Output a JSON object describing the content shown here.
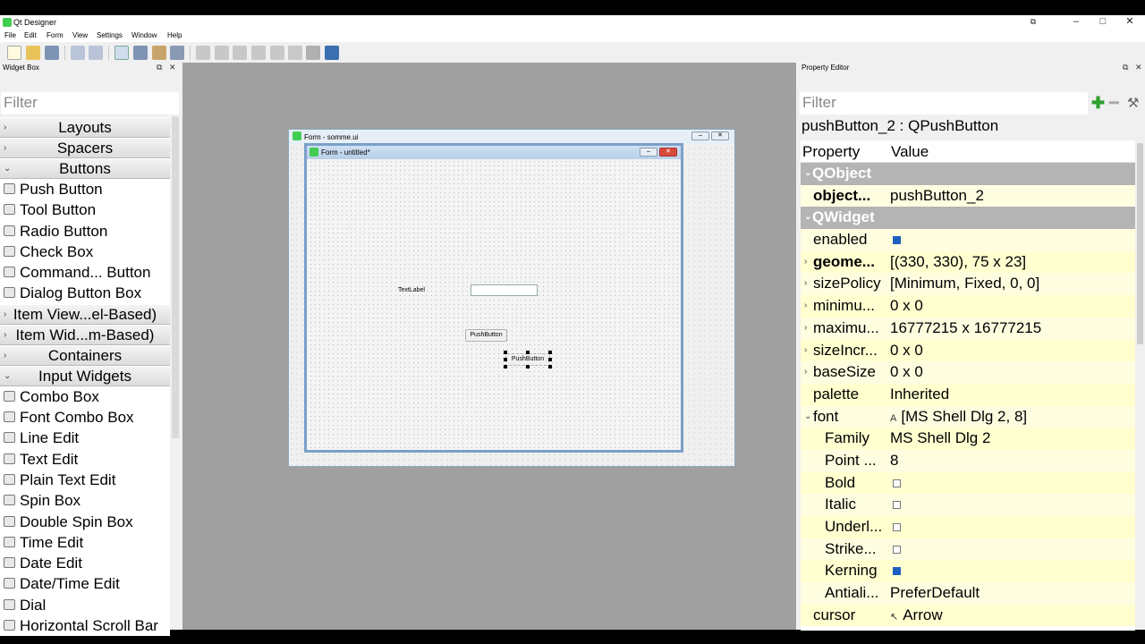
{
  "window": {
    "title": "Qt Designer"
  },
  "menu": [
    "File",
    "Edit",
    "Form",
    "View",
    "Settings",
    "Window",
    "Help"
  ],
  "widget_box": {
    "title": "Widget Box",
    "filter_placeholder": "Filter",
    "entries": [
      {
        "kind": "category",
        "label": "Layouts",
        "arrow": "›"
      },
      {
        "kind": "category",
        "label": "Spacers",
        "arrow": "›"
      },
      {
        "kind": "category",
        "label": "Buttons",
        "arrow": "⌄"
      },
      {
        "kind": "item",
        "label": "Push Button",
        "icon": "push-button-icon"
      },
      {
        "kind": "item",
        "label": "Tool Button",
        "icon": "tool-button-icon"
      },
      {
        "kind": "item",
        "label": "Radio Button",
        "icon": "radio-button-icon"
      },
      {
        "kind": "item",
        "label": "Check Box",
        "icon": "check-box-icon"
      },
      {
        "kind": "item",
        "label": "Command... Button",
        "icon": "command-link-icon"
      },
      {
        "kind": "item",
        "label": "Dialog Button Box",
        "icon": "dialog-button-box-icon"
      },
      {
        "kind": "category",
        "label": "Item View...el-Based)",
        "arrow": "›"
      },
      {
        "kind": "category",
        "label": "Item Wid...m-Based)",
        "arrow": "›"
      },
      {
        "kind": "category",
        "label": "Containers",
        "arrow": "›"
      },
      {
        "kind": "category",
        "label": "Input Widgets",
        "arrow": "⌄"
      },
      {
        "kind": "item",
        "label": "Combo Box",
        "icon": "combo-box-icon"
      },
      {
        "kind": "item",
        "label": "Font Combo Box",
        "icon": "font-combo-box-icon"
      },
      {
        "kind": "item",
        "label": "Line Edit",
        "icon": "line-edit-icon"
      },
      {
        "kind": "item",
        "label": "Text Edit",
        "icon": "text-edit-icon"
      },
      {
        "kind": "item",
        "label": "Plain Text Edit",
        "icon": "plain-text-edit-icon"
      },
      {
        "kind": "item",
        "label": "Spin Box",
        "icon": "spin-box-icon"
      },
      {
        "kind": "item",
        "label": "Double Spin Box",
        "icon": "double-spin-box-icon"
      },
      {
        "kind": "item",
        "label": "Time Edit",
        "icon": "time-edit-icon"
      },
      {
        "kind": "item",
        "label": "Date Edit",
        "icon": "date-edit-icon"
      },
      {
        "kind": "item",
        "label": "Date/Time Edit",
        "icon": "date-time-edit-icon"
      },
      {
        "kind": "item",
        "label": "Dial",
        "icon": "dial-icon"
      },
      {
        "kind": "item",
        "label": "Horizontal Scroll Bar",
        "icon": "horizontal-scroll-bar-icon"
      }
    ]
  },
  "forms": {
    "outer_title": "Form - somme.ui",
    "inner_title": "Form - untitled*",
    "text_label": "TextLabel",
    "push_button_1": "PushButton",
    "push_button_2": "PushButton"
  },
  "property_editor": {
    "title": "Property Editor",
    "filter_placeholder": "Filter",
    "object_header": "pushButton_2 : QPushButton",
    "col_property": "Property",
    "col_value": "Value",
    "rows": [
      {
        "kind": "group",
        "name": "QObject"
      },
      {
        "kind": "prop",
        "name": "object...",
        "value": "pushButton_2",
        "bold": true,
        "bg": "#fffde0"
      },
      {
        "kind": "group",
        "name": "QWidget"
      },
      {
        "kind": "prop",
        "name": "enabled",
        "check": true,
        "bg": "#fffde0"
      },
      {
        "kind": "prop",
        "name": "geome...",
        "value": "[(330, 330), 75 x 23]",
        "bold": true,
        "expand": "›",
        "bg": "#ffffd0"
      },
      {
        "kind": "prop",
        "name": "sizePolicy",
        "value": "[Minimum, Fixed, 0, 0]",
        "expand": "›",
        "bg": "#fffde0"
      },
      {
        "kind": "prop",
        "name": "minimu...",
        "value": "0 x 0",
        "expand": "›",
        "bg": "#ffffd0"
      },
      {
        "kind": "prop",
        "name": "maximu...",
        "value": "16777215 x 16777215",
        "expand": "›",
        "bg": "#fffde0"
      },
      {
        "kind": "prop",
        "name": "sizeIncr...",
        "value": "0 x 0",
        "expand": "›",
        "bg": "#ffffd0"
      },
      {
        "kind": "prop",
        "name": "baseSize",
        "value": "0 x 0",
        "expand": "›",
        "bg": "#fffde0"
      },
      {
        "kind": "prop",
        "name": "palette",
        "value": "Inherited",
        "bg": "#ffffd0"
      },
      {
        "kind": "prop",
        "name": "font",
        "value": "[MS Shell Dlg 2, 8]",
        "prefix": "A",
        "expand": "⌄",
        "bg": "#fffde0"
      },
      {
        "kind": "sub",
        "name": "Family",
        "value": "MS Shell Dlg 2",
        "bg": "#ffffd0"
      },
      {
        "kind": "sub",
        "name": "Point ...",
        "value": "8",
        "bg": "#fffde0"
      },
      {
        "kind": "sub",
        "name": "Bold",
        "check": false,
        "bg": "#ffffd0"
      },
      {
        "kind": "sub",
        "name": "Italic",
        "check": false,
        "bg": "#fffde0"
      },
      {
        "kind": "sub",
        "name": "Underl...",
        "check": false,
        "bg": "#ffffd0"
      },
      {
        "kind": "sub",
        "name": "Strike...",
        "check": false,
        "bg": "#fffde0"
      },
      {
        "kind": "sub",
        "name": "Kerning",
        "check": true,
        "bg": "#ffffd0"
      },
      {
        "kind": "sub",
        "name": "Antiali...",
        "value": "PreferDefault",
        "bg": "#fffde0"
      },
      {
        "kind": "prop",
        "name": "cursor",
        "value": "Arrow",
        "prefix": "↖",
        "bg": "#ffffd0"
      }
    ]
  }
}
